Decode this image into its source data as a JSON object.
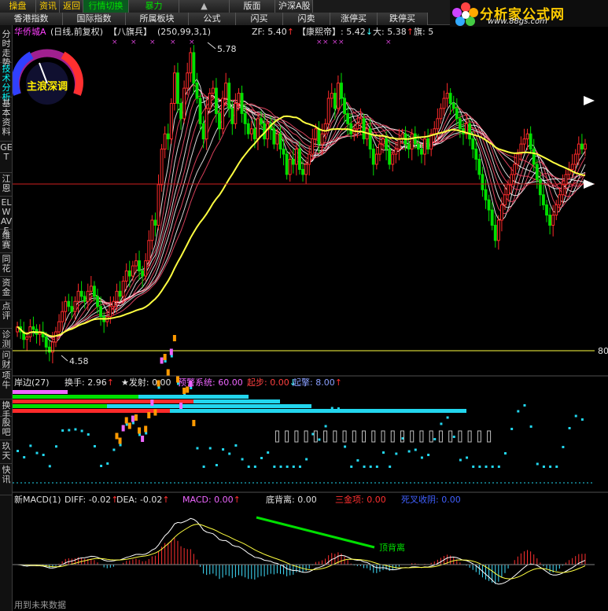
{
  "colors": {
    "up": "#ff2a2a",
    "down": "#00e000",
    "ma_long": "#ffff40",
    "ribbon_white": "#ffffff",
    "ribbon_red": "#ff4b6b",
    "cyan": "#22d6ee",
    "magenta": "#ee66ff",
    "orange": "#ff9a00"
  },
  "topbar": {
    "row1": [
      {
        "label": "操盘",
        "style": "yel"
      },
      {
        "label": "资讯",
        "style": "yel"
      },
      {
        "label": "返回",
        "style": "yel"
      },
      {
        "label": "行情切换",
        "style": "grn hl"
      },
      {
        "label": "暴力",
        "style": "grn"
      },
      {
        "label": "▲",
        "style": "arrow"
      },
      {
        "label": "版面",
        "style": ""
      },
      {
        "label": "沪深A股",
        "style": ""
      }
    ],
    "row2": [
      {
        "label": "香港指数",
        "style": ""
      },
      {
        "label": "国际指数",
        "style": ""
      },
      {
        "label": "所属板块",
        "style": ""
      },
      {
        "label": "公式",
        "style": ""
      },
      {
        "label": "闪买",
        "style": ""
      },
      {
        "label": "闪卖",
        "style": ""
      },
      {
        "label": "涨停买",
        "style": ""
      },
      {
        "label": "跌停买",
        "style": ""
      }
    ]
  },
  "logo": {
    "title": "分析家公式网",
    "url": "www.88gs.com"
  },
  "sidebar": [
    {
      "label": "分时走势",
      "active": false
    },
    {
      "label": "技术分析",
      "active": true
    },
    {
      "label": "基本资料",
      "active": false
    },
    {
      "label": "GET",
      "active": false
    },
    {
      "label": "江恩",
      "active": false
    },
    {
      "label": "ELWAVE",
      "active": false
    },
    {
      "label": "维赛",
      "active": false
    },
    {
      "label": "同花",
      "active": false
    },
    {
      "label": "资金",
      "active": false
    },
    {
      "label": "点评",
      "active": false
    },
    {
      "label": "诊测",
      "active": false
    },
    {
      "label": "问财",
      "active": false
    },
    {
      "label": "项牛",
      "active": false
    },
    {
      "label": "换手",
      "active": false
    },
    {
      "label": "股吧",
      "active": false
    },
    {
      "label": "玖天",
      "active": false
    },
    {
      "label": "快讯",
      "active": false
    }
  ],
  "main_panel": {
    "stock": "华侨城A",
    "mode": "(日线,前复权)",
    "indicator": "【八旗兵】",
    "params": "(250,99,3,1)",
    "readouts": [
      {
        "label": "ZF: 5.40",
        "arrow": "↑",
        "color": "#e0e0e0"
      },
      {
        "label": "【康熙帝】: 5.42",
        "arrow": "↓",
        "color": "#e0e0e0"
      },
      {
        "label": "大: 5.38",
        "arrow": "↑",
        "color": "#e0e0e0"
      },
      {
        "label": "旗: 5",
        "arrow": "",
        "color": "#e0e0e0"
      }
    ],
    "gauge_label": "主浪深调",
    "high_label": "5.78",
    "low_label": "4.58",
    "right_label": "80."
  },
  "sub1": {
    "title": "岸边(27)",
    "items": [
      {
        "label": "换手: 2.96",
        "arrow": "↑",
        "color": "#e0e0e0",
        "icon": ""
      },
      {
        "label": "发射: 0.00",
        "arrow": "",
        "color": "#e0e0e0",
        "icon": "★"
      },
      {
        "label": "预警系统: 60.00",
        "arrow": "",
        "color": "#ee66ff",
        "icon": ""
      },
      {
        "label": "起步: 0.00",
        "arrow": "↓",
        "color": "#ff4040",
        "icon": ""
      },
      {
        "label": "起擎: 8.00",
        "arrow": "↑",
        "color": "#8aa0ff",
        "icon": ""
      }
    ]
  },
  "sub2": {
    "title": "新MACD(1)",
    "items": [
      {
        "label": "DIFF: -0.02",
        "arrow": "↑",
        "color": "#e0e0e0"
      },
      {
        "label": "DEA: -0.02",
        "arrow": "↑",
        "color": "#e0e0e0"
      },
      {
        "label": "MACD: 0.00",
        "arrow": "↑",
        "color": "#ee66ff"
      },
      {
        "label": "底背离: 0.00",
        "arrow": "",
        "color": "#e0e0e0"
      },
      {
        "label": "三金项: 0.00",
        "arrow": "",
        "color": "#ff3030"
      },
      {
        "label": "死叉收阴: 0.00",
        "arrow": "",
        "color": "#4060ff"
      }
    ],
    "annotation": "顶背离"
  },
  "status": "用到未来数据",
  "chart_data": {
    "type": "candlestick",
    "x": [
      1,
      2,
      3,
      4,
      5,
      6,
      7,
      8,
      9,
      10,
      11,
      12,
      13,
      14,
      15,
      16,
      17,
      18,
      19,
      20,
      21,
      22,
      23,
      24,
      25,
      26,
      27,
      28,
      29,
      30,
      31,
      32,
      33,
      34,
      35,
      36,
      37,
      38,
      39,
      40,
      41,
      42,
      43,
      44,
      45,
      46,
      47,
      48,
      49,
      50,
      51,
      52,
      53,
      54,
      55,
      56,
      57,
      58,
      59,
      60,
      61,
      62,
      63,
      64,
      65,
      66,
      67,
      68,
      69,
      70,
      71,
      72,
      73,
      74,
      75,
      76,
      77,
      78,
      79,
      80,
      81,
      82,
      83,
      84,
      85,
      86,
      87,
      88,
      89,
      90,
      91,
      92,
      93,
      94,
      95,
      96,
      97,
      98,
      99,
      100,
      101,
      102,
      103,
      104,
      105,
      106,
      107,
      108,
      109,
      110,
      111,
      112,
      113,
      114,
      115,
      116,
      117,
      118,
      119,
      120,
      121,
      122,
      123,
      124,
      125,
      126,
      127,
      128,
      129,
      130,
      131,
      132,
      133,
      134,
      135,
      136,
      137,
      138,
      139,
      140,
      141,
      142,
      143,
      144,
      145,
      146,
      147,
      148,
      149,
      150,
      151,
      152,
      153,
      154,
      155,
      156,
      157,
      158,
      159,
      160,
      161,
      162,
      163,
      164,
      165,
      166,
      167,
      168,
      169,
      170,
      171,
      172,
      173,
      174,
      175,
      176,
      177,
      178,
      179,
      180
    ],
    "close": [
      4.7,
      4.68,
      4.65,
      4.66,
      4.7,
      4.69,
      4.67,
      4.68,
      4.66,
      4.62,
      4.6,
      4.64,
      4.68,
      4.72,
      4.76,
      4.8,
      4.78,
      4.76,
      4.8,
      4.84,
      4.82,
      4.8,
      4.84,
      4.86,
      4.82,
      4.78,
      4.74,
      4.72,
      4.74,
      4.78,
      4.8,
      4.84,
      4.82,
      4.88,
      4.92,
      4.9,
      4.94,
      4.96,
      4.92,
      4.9,
      4.96,
      5.04,
      5.12,
      5.1,
      5.26,
      5.4,
      5.46,
      5.44,
      5.58,
      5.7,
      5.58,
      5.52,
      5.64,
      5.7,
      5.78,
      5.66,
      5.6,
      5.5,
      5.44,
      5.56,
      5.62,
      5.64,
      5.54,
      5.48,
      5.6,
      5.66,
      5.56,
      5.5,
      5.58,
      5.62,
      5.54,
      5.5,
      5.46,
      5.48,
      5.44,
      5.52,
      5.5,
      5.44,
      5.5,
      5.48,
      5.42,
      5.46,
      5.4,
      5.38,
      5.3,
      5.36,
      5.34,
      5.4,
      5.32,
      5.3,
      5.34,
      5.38,
      5.44,
      5.48,
      5.42,
      5.46,
      5.5,
      5.6,
      5.62,
      5.56,
      5.66,
      5.6,
      5.54,
      5.5,
      5.46,
      5.48,
      5.5,
      5.52,
      5.44,
      5.48,
      5.4,
      5.34,
      5.38,
      5.42,
      5.44,
      5.4,
      5.34,
      5.38,
      5.4,
      5.44,
      5.46,
      5.42,
      5.4,
      5.46,
      5.42,
      5.4,
      5.38,
      5.44,
      5.4,
      5.46,
      5.48,
      5.52,
      5.56,
      5.6,
      5.62,
      5.58,
      5.56,
      5.52,
      5.48,
      5.46,
      5.5,
      5.44,
      5.4,
      5.36,
      5.3,
      5.24,
      5.2,
      5.16,
      5.1,
      5.04,
      5.12,
      5.18,
      5.22,
      5.26,
      5.3,
      5.34,
      5.38,
      5.42,
      5.44,
      5.46,
      5.4,
      5.34,
      5.28,
      5.22,
      5.18,
      5.14,
      5.1,
      5.14,
      5.18,
      5.22,
      5.26,
      5.3,
      5.32,
      5.34,
      5.38,
      5.42,
      5.4,
      5.42
    ],
    "ylim": [
      4.55,
      5.82
    ]
  }
}
